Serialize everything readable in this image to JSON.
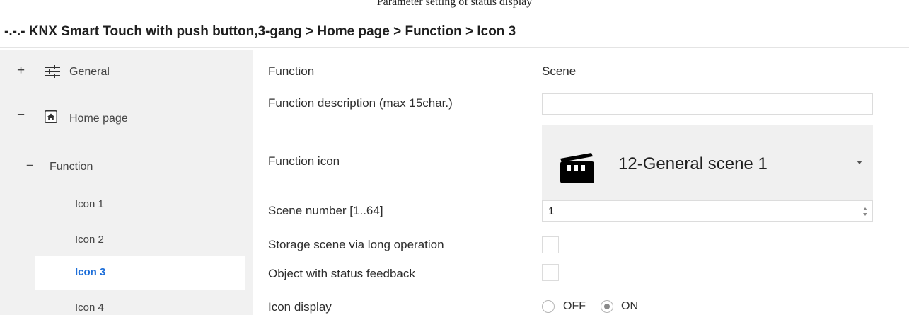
{
  "caption": "Parameter setting of status display",
  "breadcrumb": "-.-.- KNX Smart Touch with push button,3-gang > Home page > Function > Icon 3",
  "sidebar": {
    "general": {
      "toggle": "+",
      "icon": "sliders-icon",
      "label": "General"
    },
    "home": {
      "toggle": "−",
      "icon": "home-icon",
      "label": "Home page"
    },
    "function": {
      "toggle": "−",
      "label": "Function"
    },
    "icons": [
      {
        "label": "Icon 1"
      },
      {
        "label": "Icon 2"
      },
      {
        "label": "Icon 3",
        "selected": true
      },
      {
        "label": "Icon 4"
      }
    ]
  },
  "params": {
    "function": {
      "label": "Function",
      "value": "Scene"
    },
    "description": {
      "label": "Function description (max 15char.)",
      "value": ""
    },
    "function_icon": {
      "label": "Function icon",
      "value": "12-General scene 1",
      "icon": "clapperboard-icon"
    },
    "scene_number": {
      "label": "Scene number [1..64]",
      "value": "1"
    },
    "storage_scene": {
      "label": "Storage scene via long operation",
      "checked": false
    },
    "status_feedback": {
      "label": "Object with status feedback",
      "checked": false
    },
    "icon_display": {
      "label": "Icon display",
      "options": [
        "OFF",
        "ON"
      ],
      "selected": "ON"
    }
  },
  "colors": {
    "selected_text": "#1e6fd9",
    "sidebar_bg": "#f1f1f1",
    "dropdown_bg": "#f0f0f0"
  }
}
